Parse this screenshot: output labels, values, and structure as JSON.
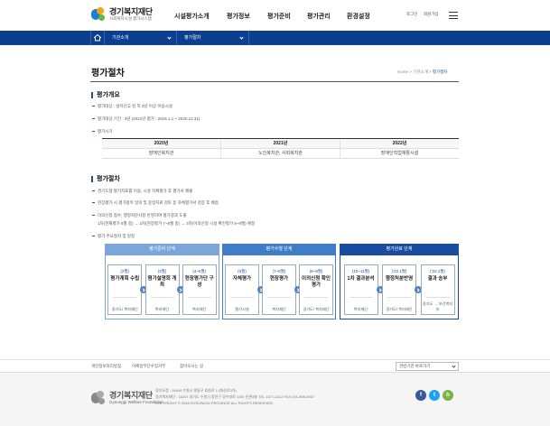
{
  "header": {
    "logo_main": "경기복지재단",
    "logo_sub": "사회복지시설 평가시스템",
    "gnb": [
      "시설평가소개",
      "평가정보",
      "평가준비",
      "평가관리",
      "환경설정"
    ],
    "login": "로그인",
    "join": "회원가입"
  },
  "locbar": {
    "item1": "기관소개",
    "item2": "평가절차"
  },
  "page": {
    "title": "평가절차",
    "breadcrumb_home": "Home",
    "breadcrumb_1": "기관소개",
    "breadcrumb_2": "평가절차"
  },
  "overview": {
    "title": "평가개요",
    "bullets": [
      "평가대상 : 설치신고 된 지 3년 이상 이용시설",
      "평가대상 기간 : 3년 (2021년 평가 : 2018.1.1 ~ 2020.12.31)",
      "평가시기"
    ],
    "table_head": [
      "2020년",
      "2021년",
      "2022년"
    ],
    "table_row": [
      "장애인복지관",
      "노인복지관, 사회복지관",
      "장애인직업재활시설"
    ]
  },
  "procedure": {
    "title": "평가절차",
    "bullets": [
      "경기도형 평가지표를 이용, 시설 자체평가 후 평가서 제출",
      "현장평가 시 평가항목 일의 및 증빙자료 검토 등 자체평가서 검증 후 배점",
      "이의신청 접수, 행정처분사항 반영하여 평가결과 도출",
      "1차(현재평가 6월 중) → 2차(현장평가 7~8월 중) → 3차(이의신청 시설 확인평가 8~9월) 예정",
      "평가 주요절차 및 일정"
    ]
  },
  "stages": [
    {
      "title": "평가준비 단계",
      "steps": [
        {
          "when": "(2월)",
          "what": "평가계획 수립",
          "who": "경기도/ 복지재단"
        },
        {
          "when": "(3월)",
          "what": "평가설명회 개최",
          "who": "복지재단"
        },
        {
          "when": "(4~5월)",
          "what": "현장평가단 구성",
          "who": "복지재단"
        }
      ]
    },
    {
      "title": "평가수행 단계",
      "steps": [
        {
          "when": "(6월)",
          "what": "자체평가",
          "who": "평가시설"
        },
        {
          "when": "(7~8월)",
          "what": "현장평가",
          "who": "복지재단"
        },
        {
          "when": "(8~9월)",
          "what": "이의신청 확인평가",
          "who": "경기도/ 복지재단"
        }
      ]
    },
    {
      "title": "평가완료 단계",
      "steps": [
        {
          "when": "(10~11월)",
          "what": "1차 결과분석",
          "who": "복지재단"
        },
        {
          "when": "('22.1월)",
          "what": "행정처분반영",
          "who": "경기도/ 복지재단"
        },
        {
          "when": "('22.1월)",
          "what": "결과 송부",
          "who": "경기도 → 보건복지부"
        }
      ]
    }
  ],
  "colors": {
    "navy": "#0d3f8f",
    "stage1": "#7ba6d9",
    "stage2": "#3f7ec7",
    "stage3": "#1a4da0"
  },
  "footer": {
    "links": [
      "개인정보처리방침",
      "이메일무단수집거부",
      "찾아오시는 길"
    ],
    "select": "관련기관 바로가기",
    "logo_main": "경기복지재단",
    "logo_sub": "Gyeonggi Welfare Foundation",
    "addr1": "경기도청 : 16444 수원시 팔달구 효원로 1 (매산로3가)",
    "addr2": "경기복지재단 : 16207 경기도 수원시 장안구 경수대로 1150 신관3층 TEL 1577-4312 FAX 031-898-5937",
    "copy": "COPYRIGHT © 2018 GYEONGGI PROVINCE ALL RIGHTS RESERVED.",
    "sns": [
      "f",
      "t",
      "b",
      "y"
    ]
  }
}
